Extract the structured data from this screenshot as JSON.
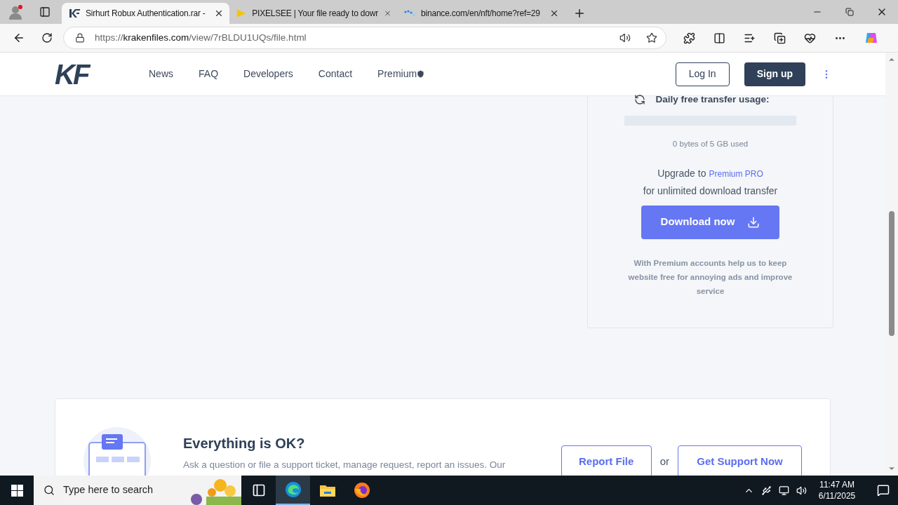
{
  "browser": {
    "tabs": [
      {
        "kind": "kf",
        "title": "Sirhurt Robux Authentication.rar -",
        "selected": true
      },
      {
        "kind": "play",
        "title": "PIXELSEE | Your file ready to dowr",
        "selected": false
      },
      {
        "kind": "dots",
        "title": "binance.com/en/nft/home?ref=29",
        "selected": false
      }
    ],
    "url_scheme": "https://",
    "url_host": "krakenfiles.com",
    "url_path": "/view/7rBLDU1UQs/file.html"
  },
  "site": {
    "logo": "KF",
    "nav": [
      {
        "label": "News",
        "kind": "plain"
      },
      {
        "label": "FAQ",
        "kind": "plain"
      },
      {
        "label": "Developers",
        "kind": "plain"
      },
      {
        "label": "Contact",
        "kind": "plain"
      },
      {
        "label": "Premium",
        "kind": "shield"
      }
    ],
    "login": "Log In",
    "signup": "Sign up"
  },
  "usage": {
    "title": "Daily free transfer usage:",
    "level": 0,
    "used": "0 bytes of 5 GB used",
    "upgrade_prefix": "Upgrade to",
    "upgrade_link": "Premium PRO",
    "upgrade_note": "for unlimited download transfer",
    "download": "Download now",
    "note": "With Premium accounts help us to keep website free for annoying ads and improve service"
  },
  "support": {
    "title": "Everything is OK?",
    "text": "Ask a question or file a support ticket, manage request, report an issues. Our",
    "report": "Report File",
    "or": "or",
    "get_support": "Get Support Now"
  },
  "taskbar": {
    "search_placeholder": "Type here to search",
    "apps": [
      {
        "kind": "task-view",
        "selected": false
      },
      {
        "kind": "edge",
        "selected": true
      },
      {
        "kind": "files",
        "selected": false
      },
      {
        "kind": "firefox",
        "selected": false
      }
    ],
    "time": "11:47 AM",
    "date": "6/11/2025"
  }
}
